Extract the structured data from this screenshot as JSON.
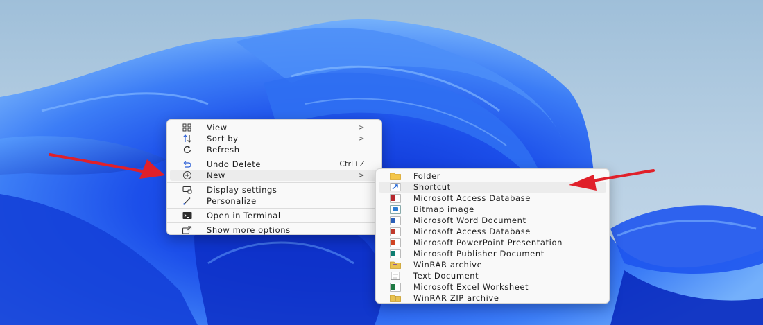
{
  "context_menu": {
    "items": [
      {
        "label": "View",
        "has_submenu": true,
        "icon": "view-grid-icon"
      },
      {
        "label": "Sort by",
        "has_submenu": true,
        "icon": "sort-icon"
      },
      {
        "label": "Refresh",
        "icon": "refresh-icon"
      },
      {
        "label": "Undo Delete",
        "shortcut": "Ctrl+Z",
        "icon": "undo-icon"
      },
      {
        "label": "New",
        "has_submenu": true,
        "icon": "new-plus-icon",
        "highlighted": true
      },
      {
        "label": "Display settings",
        "icon": "display-icon"
      },
      {
        "label": "Personalize",
        "icon": "brush-icon"
      },
      {
        "label": "Open in Terminal",
        "icon": "terminal-icon"
      },
      {
        "label": "Show more options",
        "icon": "more-options-icon"
      }
    ],
    "chevron": ">"
  },
  "new_submenu": {
    "items": [
      {
        "label": "Folder",
        "icon": "folder-icon"
      },
      {
        "label": "Shortcut",
        "icon": "shortcut-icon",
        "highlighted": true
      },
      {
        "label": "Microsoft Access Database",
        "icon": "access-file-icon"
      },
      {
        "label": "Bitmap image",
        "icon": "bitmap-file-icon"
      },
      {
        "label": "Microsoft Word Document",
        "icon": "word-file-icon"
      },
      {
        "label": "Microsoft Access Database",
        "icon": "access-file-icon"
      },
      {
        "label": "Microsoft PowerPoint Presentation",
        "icon": "powerpoint-file-icon"
      },
      {
        "label": "Microsoft Publisher Document",
        "icon": "publisher-file-icon"
      },
      {
        "label": "WinRAR archive",
        "icon": "winrar-archive-icon"
      },
      {
        "label": "Text Document",
        "icon": "text-file-icon"
      },
      {
        "label": "Microsoft Excel Worksheet",
        "icon": "excel-file-icon"
      },
      {
        "label": "WinRAR ZIP archive",
        "icon": "winrar-zip-icon"
      }
    ]
  },
  "colors": {
    "annotation_arrow": "#e0202a",
    "wallpaper_blue": "#1f5cf0",
    "menu_bg": "#f9f9f9",
    "highlight_bg": "#ececec"
  }
}
